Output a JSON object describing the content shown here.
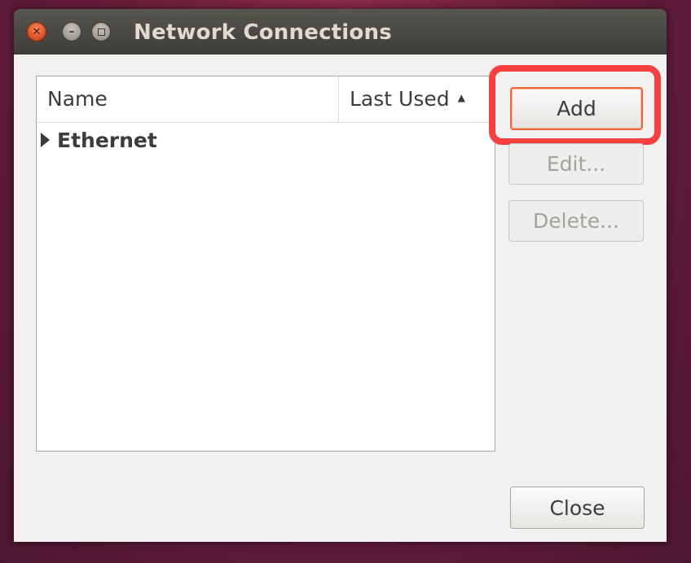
{
  "window": {
    "title": "Network Connections",
    "controls": {
      "close_icon": "close-icon",
      "minimize_icon": "minimize-icon",
      "maximize_icon": "maximize-icon"
    }
  },
  "connections_list": {
    "columns": [
      {
        "label": "Name"
      },
      {
        "label": "Last Used",
        "sort": "ascending",
        "sort_icon": "sort-ascending-icon"
      }
    ],
    "groups": [
      {
        "label": "Ethernet",
        "expanded": false,
        "expander_icon": "expander-collapsed-icon"
      }
    ]
  },
  "buttons": {
    "add": {
      "label": "Add",
      "enabled": true,
      "focused": true
    },
    "edit": {
      "label": "Edit...",
      "enabled": false
    },
    "delete": {
      "label": "Delete...",
      "enabled": false
    },
    "close": {
      "label": "Close",
      "enabled": true
    }
  },
  "colors": {
    "annotation_highlight": "#f44040",
    "focus_accent": "#e8693a",
    "titlebar": "#3e3d38",
    "window_bg": "#f2f1f0"
  }
}
